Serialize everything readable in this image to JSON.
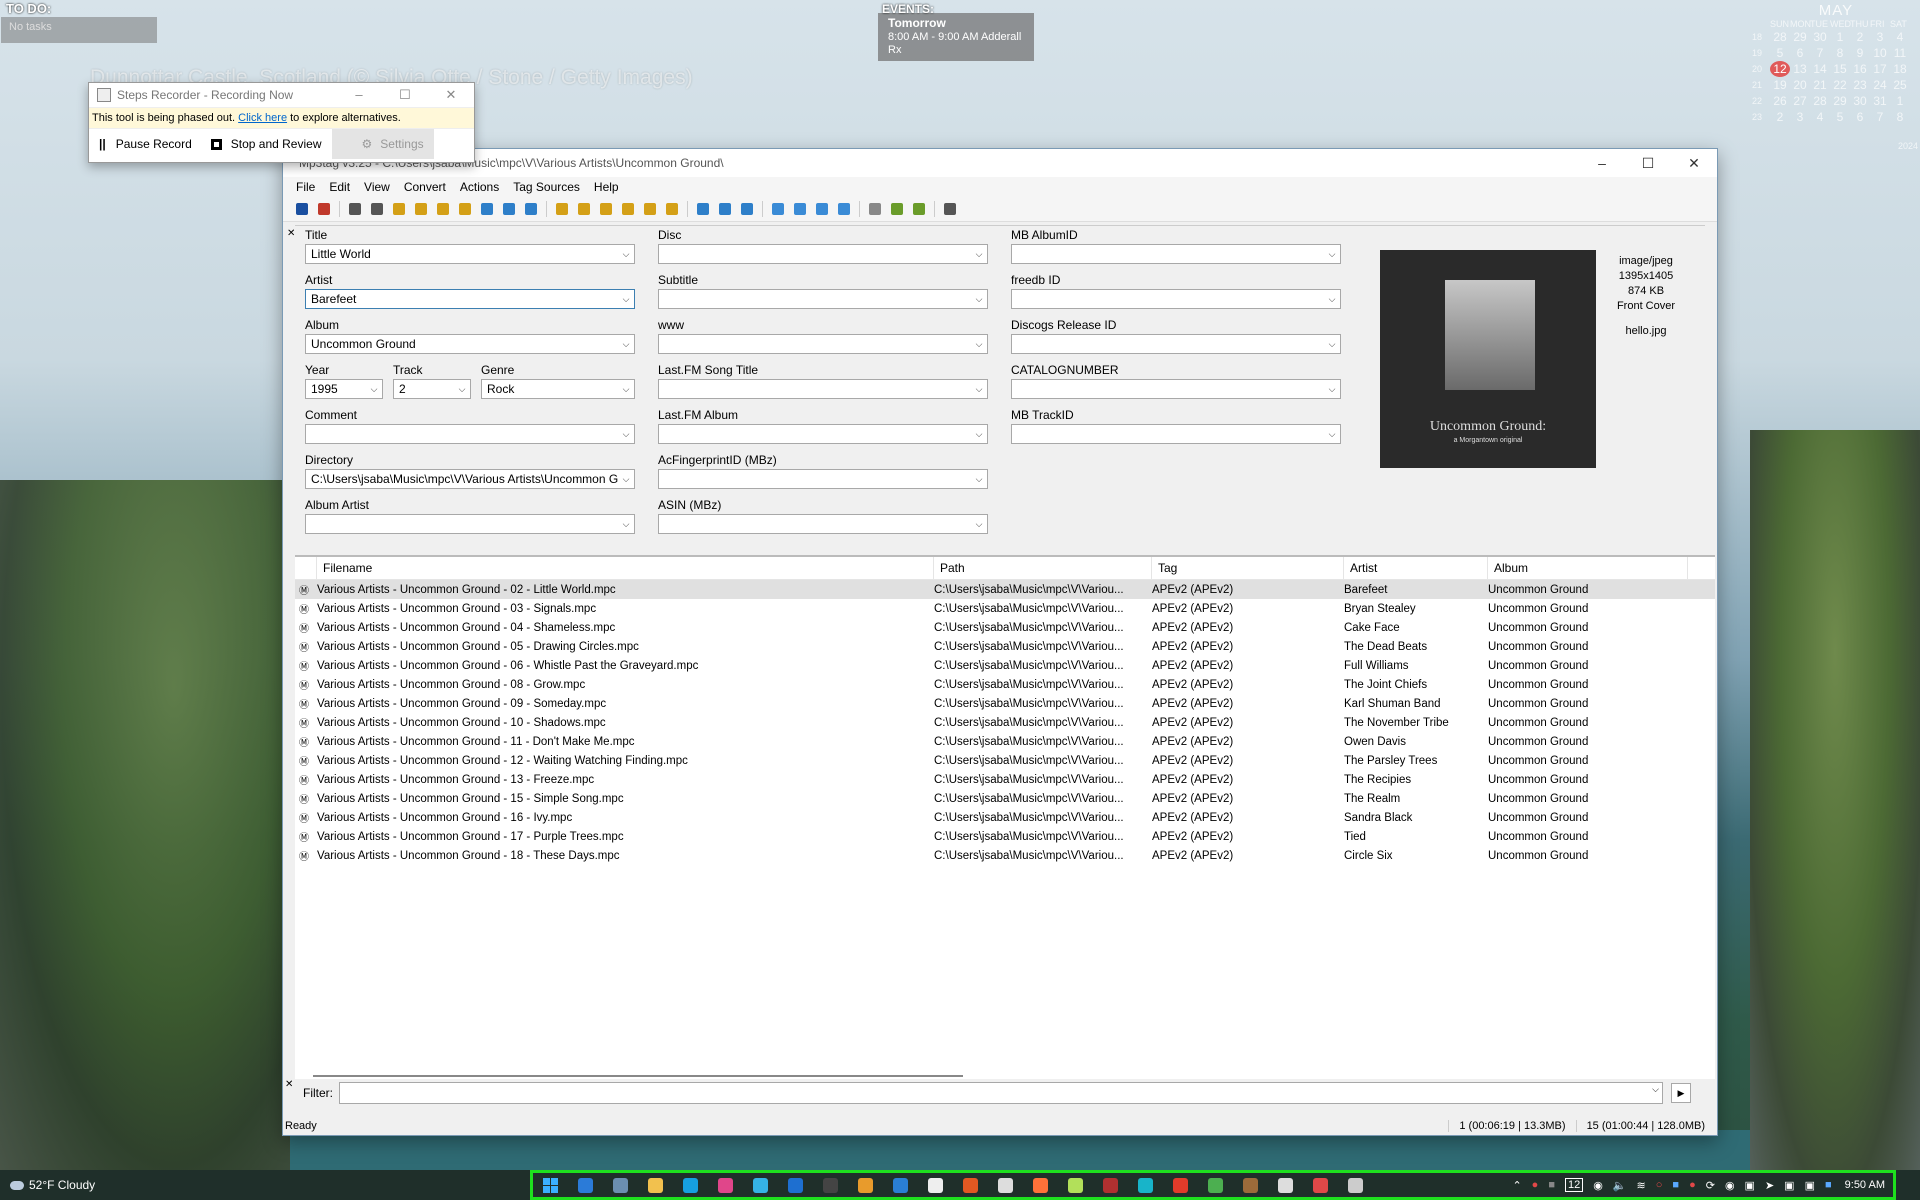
{
  "desktop": {
    "caption": "Dunnottar Castle, Scotland (© Silvia Otte / Stone / Getty Images)",
    "todo": {
      "title": "TO DO:",
      "text": "No tasks"
    },
    "events": {
      "title": "EVENTS:",
      "when": "Tomorrow",
      "line1": "8:00 AM - 9:00 AM Adderall",
      "line2": "Rx"
    },
    "calendar": {
      "month": "MAY",
      "year": "2024",
      "dows": [
        "SUN",
        "MON",
        "TUE",
        "WED",
        "THU",
        "FRI",
        "SAT"
      ],
      "weeks": [
        {
          "wk": "18",
          "days": [
            "28",
            "29",
            "30",
            "1",
            "2",
            "3",
            "4"
          ]
        },
        {
          "wk": "19",
          "days": [
            "5",
            "6",
            "7",
            "8",
            "9",
            "10",
            "11"
          ]
        },
        {
          "wk": "20",
          "days": [
            "12",
            "13",
            "14",
            "15",
            "16",
            "17",
            "18"
          ]
        },
        {
          "wk": "21",
          "days": [
            "19",
            "20",
            "21",
            "22",
            "23",
            "24",
            "25"
          ]
        },
        {
          "wk": "22",
          "days": [
            "26",
            "27",
            "28",
            "29",
            "30",
            "31",
            "1"
          ]
        },
        {
          "wk": "23",
          "days": [
            "2",
            "3",
            "4",
            "5",
            "6",
            "7",
            "8"
          ]
        }
      ],
      "today": "12"
    }
  },
  "steps_recorder": {
    "title": "Steps Recorder - Recording Now",
    "notice_pre": "This tool is being phased out.",
    "notice_link": "Click here",
    "notice_post": "to explore alternatives.",
    "pause": "Pause Record",
    "stop": "Stop and Review",
    "settings": "Settings"
  },
  "window": {
    "title": "Mp3tag v3.25 - C:\\Users\\jsaba\\Music\\mpc\\V\\Various Artists\\Uncommon Ground\\",
    "menu": [
      "File",
      "Edit",
      "View",
      "Convert",
      "Actions",
      "Tag Sources",
      "Help"
    ],
    "toolbar_colors": [
      "#1a4fa0",
      "#c0392b",
      "#555",
      "#555",
      "#d4a017",
      "#d4a017",
      "#d4a017",
      "#d4a017",
      "#2e7fc9",
      "#2e7fc9",
      "#2e7fc9",
      "#d4a017",
      "#d4a017",
      "#d4a017",
      "#d4a017",
      "#d4a017",
      "#d4a017",
      "#2e7fc9",
      "#2e7fc9",
      "#2e7fc9",
      "#3a8bd6",
      "#3a8bd6",
      "#3a8bd6",
      "#3a8bd6",
      "#888",
      "#6a9c2a",
      "#6a9c2a",
      "#555"
    ],
    "fields": {
      "title": {
        "label": "Title",
        "value": "Little World"
      },
      "artist": {
        "label": "Artist",
        "value": "Barefeet"
      },
      "album": {
        "label": "Album",
        "value": "Uncommon Ground"
      },
      "year": {
        "label": "Year",
        "value": "1995"
      },
      "track": {
        "label": "Track",
        "value": "2"
      },
      "genre": {
        "label": "Genre",
        "value": "Rock"
      },
      "comment": {
        "label": "Comment",
        "value": ""
      },
      "directory": {
        "label": "Directory",
        "value": "C:\\Users\\jsaba\\Music\\mpc\\V\\Various Artists\\Uncommon Gr"
      },
      "album_artist": {
        "label": "Album Artist",
        "value": ""
      },
      "disc": {
        "label": "Disc",
        "value": ""
      },
      "subtitle": {
        "label": "Subtitle",
        "value": ""
      },
      "www": {
        "label": "www",
        "value": ""
      },
      "lastfm_song": {
        "label": "Last.FM Song Title",
        "value": ""
      },
      "lastfm_album": {
        "label": "Last.FM Album",
        "value": ""
      },
      "acfp": {
        "label": "AcFingerprintID (MBz)",
        "value": ""
      },
      "asin": {
        "label": "ASIN (MBz)",
        "value": ""
      },
      "mb_album": {
        "label": "MB AlbumID",
        "value": ""
      },
      "freedb": {
        "label": "freedb ID",
        "value": ""
      },
      "discogs": {
        "label": "Discogs Release ID",
        "value": ""
      },
      "catalog": {
        "label": "CATALOGNUMBER",
        "value": ""
      },
      "mb_track": {
        "label": "MB TrackID",
        "value": ""
      }
    },
    "cover": {
      "title": "Uncommon Ground:",
      "subtitle": "a Morgantown original",
      "mime": "image/jpeg",
      "dims": "1395x1405",
      "size": "874 KB",
      "type": "Front Cover",
      "file": "hello.jpg"
    },
    "columns": [
      "Filename",
      "Path",
      "Tag",
      "Artist",
      "Album"
    ],
    "rows": [
      [
        "Various Artists  - Uncommon Ground -  02  - Little World.mpc",
        "C:\\Users\\jsaba\\Music\\mpc\\V\\Variou...",
        "APEv2 (APEv2)",
        "Barefeet",
        "Uncommon Ground"
      ],
      [
        "Various Artists  - Uncommon Ground -  03  - Signals.mpc",
        "C:\\Users\\jsaba\\Music\\mpc\\V\\Variou...",
        "APEv2 (APEv2)",
        "Bryan Stealey",
        "Uncommon Ground"
      ],
      [
        "Various Artists  - Uncommon Ground -  04  - Shameless.mpc",
        "C:\\Users\\jsaba\\Music\\mpc\\V\\Variou...",
        "APEv2 (APEv2)",
        "Cake Face",
        "Uncommon Ground"
      ],
      [
        "Various Artists  - Uncommon Ground -  05  - Drawing Circles.mpc",
        "C:\\Users\\jsaba\\Music\\mpc\\V\\Variou...",
        "APEv2 (APEv2)",
        "The Dead Beats",
        "Uncommon Ground"
      ],
      [
        "Various Artists  - Uncommon Ground -  06  - Whistle Past the Graveyard.mpc",
        "C:\\Users\\jsaba\\Music\\mpc\\V\\Variou...",
        "APEv2 (APEv2)",
        "Full Williams",
        "Uncommon Ground"
      ],
      [
        "Various Artists  - Uncommon Ground -  08  - Grow.mpc",
        "C:\\Users\\jsaba\\Music\\mpc\\V\\Variou...",
        "APEv2 (APEv2)",
        "The Joint Chiefs",
        "Uncommon Ground"
      ],
      [
        "Various Artists  - Uncommon Ground -  09  - Someday.mpc",
        "C:\\Users\\jsaba\\Music\\mpc\\V\\Variou...",
        "APEv2 (APEv2)",
        "Karl Shuman Band",
        "Uncommon Ground"
      ],
      [
        "Various Artists  - Uncommon Ground -  10  - Shadows.mpc",
        "C:\\Users\\jsaba\\Music\\mpc\\V\\Variou...",
        "APEv2 (APEv2)",
        "The November Tribe",
        "Uncommon Ground"
      ],
      [
        "Various Artists  - Uncommon Ground -  11  - Don't Make Me.mpc",
        "C:\\Users\\jsaba\\Music\\mpc\\V\\Variou...",
        "APEv2 (APEv2)",
        "Owen Davis",
        "Uncommon Ground"
      ],
      [
        "Various Artists  - Uncommon Ground -  12  - Waiting Watching Finding.mpc",
        "C:\\Users\\jsaba\\Music\\mpc\\V\\Variou...",
        "APEv2 (APEv2)",
        "The Parsley Trees",
        "Uncommon Ground"
      ],
      [
        "Various Artists  - Uncommon Ground -  13  - Freeze.mpc",
        "C:\\Users\\jsaba\\Music\\mpc\\V\\Variou...",
        "APEv2 (APEv2)",
        "The Recipies",
        "Uncommon Ground"
      ],
      [
        "Various Artists  - Uncommon Ground -  15  - Simple Song.mpc",
        "C:\\Users\\jsaba\\Music\\mpc\\V\\Variou...",
        "APEv2 (APEv2)",
        "The Realm",
        "Uncommon Ground"
      ],
      [
        "Various Artists  - Uncommon Ground -  16  - Ivy.mpc",
        "C:\\Users\\jsaba\\Music\\mpc\\V\\Variou...",
        "APEv2 (APEv2)",
        "Sandra Black",
        "Uncommon Ground"
      ],
      [
        "Various Artists  - Uncommon Ground -  17  - Purple Trees.mpc",
        "C:\\Users\\jsaba\\Music\\mpc\\V\\Variou...",
        "APEv2 (APEv2)",
        "Tied",
        "Uncommon Ground"
      ],
      [
        "Various Artists  - Uncommon Ground -  18  - These Days.mpc",
        "C:\\Users\\jsaba\\Music\\mpc\\V\\Variou...",
        "APEv2 (APEv2)",
        "Circle Six",
        "Uncommon Ground"
      ]
    ],
    "filter_label": "Filter:",
    "status": "Ready",
    "status_sel": "1 (00:06:19 | 13.3MB)",
    "status_total": "15 (01:00:44 | 128.0MB)"
  },
  "taskbar": {
    "weather": "52°F Cloudy",
    "time": "9:50 AM",
    "tray_badge": "12",
    "app_colors": [
      "#2b7bd8",
      "#6b8fb0",
      "#f2c14e",
      "#16a0e0",
      "#e0468a",
      "#35b3e5",
      "#1e6fd0",
      "#444",
      "#e89b2c",
      "#2a7fd4",
      "#eee",
      "#e25822",
      "#ddd",
      "#ff7139",
      "#b2e05a",
      "#b03030",
      "#18b4c9",
      "#e23b2a",
      "#4caf50",
      "#9c6b3a",
      "#ddd",
      "#e04848",
      "#ccc"
    ]
  }
}
